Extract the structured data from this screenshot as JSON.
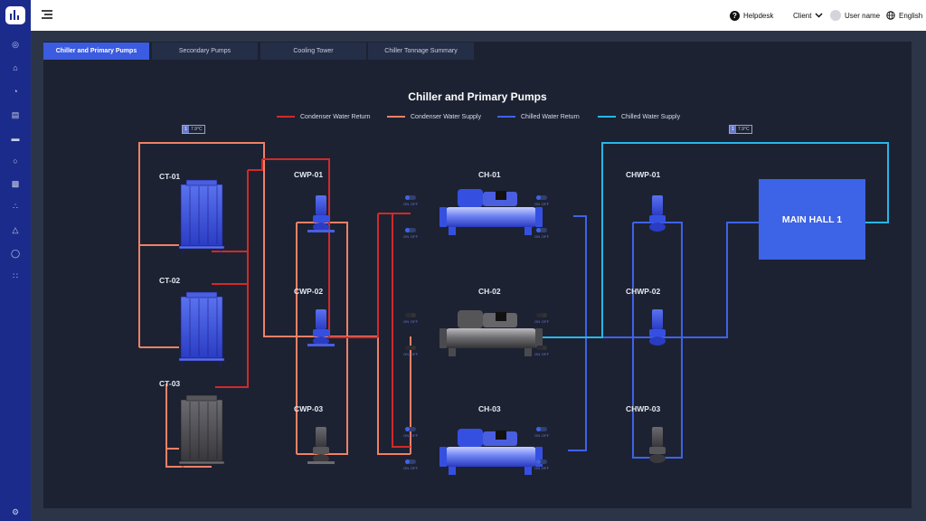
{
  "topbar": {
    "helpdesk_label": "Helpdesk",
    "client_label": "Client",
    "username_label": "User name",
    "language_label": "English"
  },
  "tabs": [
    {
      "label": "Chiller and Primary Pumps",
      "active": true
    },
    {
      "label": "Secondary Pumps",
      "active": false
    },
    {
      "label": "Cooling Tower",
      "active": false
    },
    {
      "label": "Chiller Tonnage Summary",
      "active": false
    }
  ],
  "page_title": "Chiller and Primary Pumps",
  "legend": [
    {
      "label": "Condenser Water Return",
      "color": "#d02a2a"
    },
    {
      "label": "Condenser Water Supply",
      "color": "#ef8066"
    },
    {
      "label": "Chilled Water Return",
      "color": "#3f62e8"
    },
    {
      "label": "Chilled Water Supply",
      "color": "#28b6e8"
    }
  ],
  "temperature_badges": [
    {
      "icon": "1",
      "value": "7.9°C"
    },
    {
      "icon": "1",
      "value": "7.9°C"
    }
  ],
  "cooling_towers": [
    {
      "name": "CT-01",
      "status": "on"
    },
    {
      "name": "CT-02",
      "status": "on"
    },
    {
      "name": "CT-03",
      "status": "off"
    }
  ],
  "condenser_pumps": [
    {
      "name": "CWP-01",
      "status": "on"
    },
    {
      "name": "CWP-02",
      "status": "on"
    },
    {
      "name": "CWP-03",
      "status": "off"
    }
  ],
  "chillers": [
    {
      "name": "CH-01",
      "status": "on"
    },
    {
      "name": "CH-02",
      "status": "off"
    },
    {
      "name": "CH-03",
      "status": "on"
    }
  ],
  "chilled_pumps": [
    {
      "name": "CHWP-01",
      "status": "on"
    },
    {
      "name": "CHWP-02",
      "status": "on"
    },
    {
      "name": "CHWP-03",
      "status": "off"
    }
  ],
  "toggle_text": {
    "on": "ON",
    "off": "OFF"
  },
  "main_hall_label": "MAIN HALL 1",
  "sidebar_icons": [
    "globe-icon",
    "home-icon",
    "gauge-icon",
    "clipboard-icon",
    "layout-icon",
    "location-icon",
    "building-icon",
    "network-icon",
    "warning-icon",
    "pin-icon",
    "apps-icon",
    "settings-icon"
  ],
  "colors": {
    "sidebar": "#1b2b8c",
    "accent": "#3b5be0",
    "panel": "#1c2232",
    "equipment_on": "#3550e0",
    "equipment_off": "#4a4a4e"
  }
}
